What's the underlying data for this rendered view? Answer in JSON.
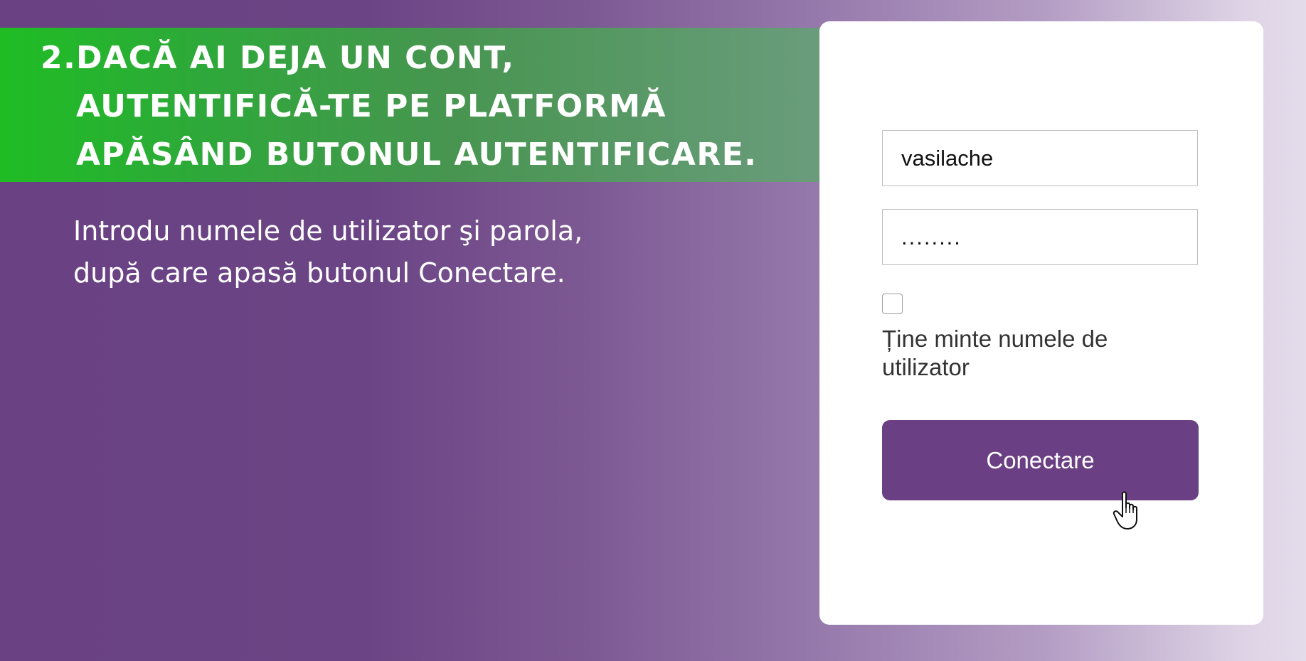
{
  "heading": {
    "number": "2.",
    "lines": [
      "DACĂ AI DEJA UN CONT,",
      "AUTENTIFICĂ-TE PE PLATFORMĂ",
      "APĂSÂND BUTONUL AUTENTIFICARE."
    ]
  },
  "instructions": {
    "lines": [
      "Introdu numele de utilizator şi parola,",
      "după care apasă butonul Conectare."
    ]
  },
  "login_form": {
    "username_value": "vasilache",
    "password_value": "........",
    "remember_label": "Ține minte numele de utilizator",
    "remember_checked": false,
    "submit_label": "Conectare"
  },
  "cursor": {
    "icon": "hand-pointer-icon"
  },
  "colors": {
    "heading_band_start": "#1fbd24",
    "heading_band_end": "#6a9c7c",
    "background_purple": "#6a4283",
    "button_purple": "#6a3f83",
    "card_background": "#ffffff"
  }
}
